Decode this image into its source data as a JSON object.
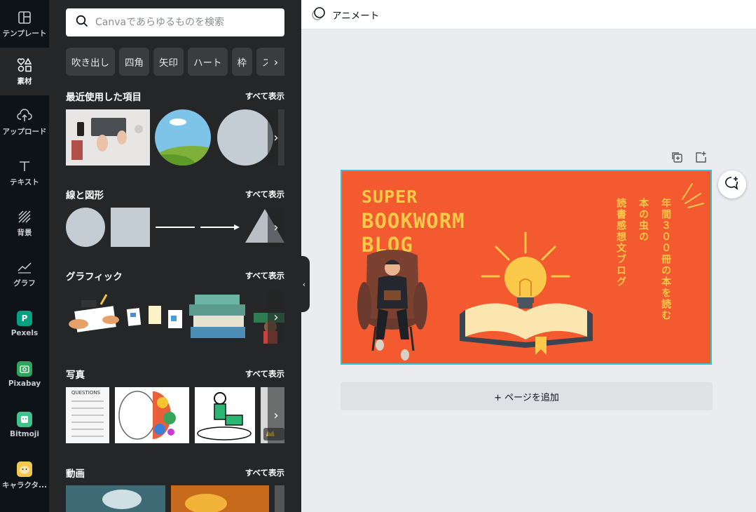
{
  "rail": {
    "items": [
      {
        "label": "テンプレート"
      },
      {
        "label": "素材"
      },
      {
        "label": "アップロード"
      },
      {
        "label": "テキスト"
      },
      {
        "label": "背景"
      },
      {
        "label": "グラフ"
      },
      {
        "label": "Pexels"
      },
      {
        "label": "Pixabay"
      },
      {
        "label": "Bitmoji"
      },
      {
        "label": "キャラクタ..."
      }
    ]
  },
  "search": {
    "placeholder": "Canvaであらゆるものを検索"
  },
  "chips": [
    "吹き出し",
    "四角",
    "矢印",
    "ハート",
    "枠",
    "ス"
  ],
  "sections": {
    "recent": {
      "title": "最近使用した項目",
      "see_all": "すべて表示"
    },
    "shapes": {
      "title": "線と図形",
      "see_all": "すべて表示"
    },
    "graphics": {
      "title": "グラフィック",
      "see_all": "すべて表示"
    },
    "photos": {
      "title": "写真",
      "see_all": "すべて表示"
    },
    "videos": {
      "title": "動画",
      "see_all": "すべて表示"
    }
  },
  "photo_questions_label": "QUESTIONS",
  "topbar": {
    "animate_label": "アニメート"
  },
  "design": {
    "title_line1": "SUPER",
    "title_line2": "BOOKWORM",
    "title_line3": "BLOG",
    "vertical_text_1": "年間３００冊の本を読む",
    "vertical_text_2": "本の虫の",
    "vertical_text_3": "読書感想文ブログ",
    "bg_color": "#f35a2f",
    "accent_color": "#fbc94a"
  },
  "add_page": {
    "label": "+ ページを追加"
  }
}
